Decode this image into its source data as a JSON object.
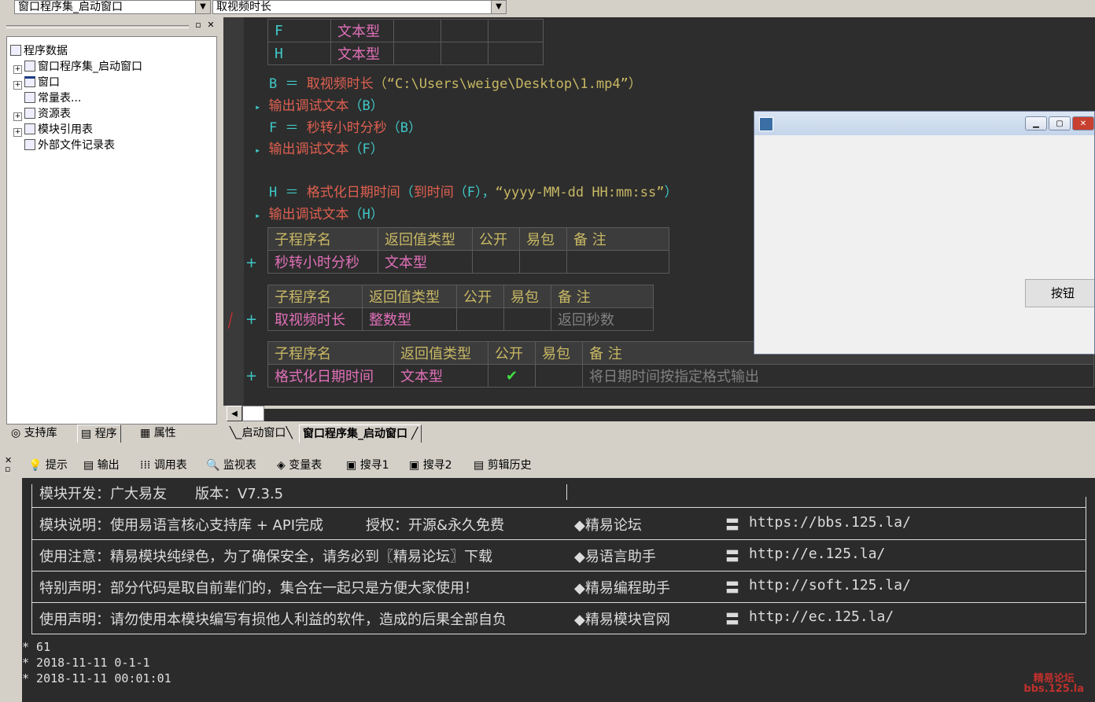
{
  "topbar": {
    "class_selector": "窗口程序集_启动窗口",
    "method_selector": "取视频时长"
  },
  "tree": {
    "root": "程序数据",
    "items": [
      {
        "label": "窗口程序集_启动窗口",
        "icon": "assembly-icon"
      },
      {
        "label": "窗口",
        "icon": "window-icon"
      },
      {
        "label": "常量表...",
        "icon": "constant-icon"
      },
      {
        "label": "资源表",
        "icon": "resource-icon"
      },
      {
        "label": "模块引用表",
        "icon": "module-icon"
      },
      {
        "label": "外部文件记录表",
        "icon": "file-icon"
      }
    ]
  },
  "left_tabs": [
    "支持库",
    "程序",
    "属性"
  ],
  "code": {
    "var_table": [
      [
        "F",
        "文本型"
      ],
      [
        "H",
        "文本型"
      ]
    ],
    "lines": {
      "l1_var": "B",
      "l1_eq": "＝",
      "l1_func": "取视频时长",
      "l1_arg": "（“C:\\Users\\weige\\Desktop\\1.mp4”）",
      "l2_func": "输出调试文本",
      "l2_arg": "（B）",
      "l3_var": "F",
      "l3_eq": "＝",
      "l3_func": "秒转小时分秒",
      "l3_arg": "（B）",
      "l4_func": "输出调试文本",
      "l4_arg": "（F）",
      "l5_var": "H",
      "l5_eq": "＝",
      "l5_func": "格式化日期时间",
      "l5_mid1": "（",
      "l5_func2": "到时间",
      "l5_mid2": "（F），",
      "l5_str": "“yyyy-MM-dd HH:mm:ss”",
      "l5_end": "）",
      "l6_func": "输出调试文本",
      "l6_arg": "（H）"
    },
    "sub_headers": [
      "子程序名",
      "返回值类型",
      "公开",
      "易包",
      "备 注"
    ],
    "subs": [
      {
        "name": "秒转小时分秒",
        "type": "文本型",
        "public": "",
        "note": ""
      },
      {
        "name": "取视频时长",
        "type": "整数型",
        "public": "",
        "note": "返回秒数"
      },
      {
        "name": "格式化日期时间",
        "type": "文本型",
        "public": "✔",
        "note": "将日期时间按指定格式输出"
      }
    ]
  },
  "doc_tabs": [
    "_启动窗口",
    "窗口程序集_启动窗口"
  ],
  "window": {
    "button_label": "按钮"
  },
  "bottom_tabs": [
    "提示",
    "输出",
    "调用表",
    "监视表",
    "变量表",
    "搜寻1",
    "搜寻2",
    "剪辑历史"
  ],
  "output": {
    "row0": {
      "left": "模块开发：广大易友　　版本：V7.3.5"
    },
    "rows": [
      {
        "left": "模块说明：使用易语言核心支持库 + API完成　　　授权：开源&永久免费",
        "site": "◆精易论坛",
        "url": "https://bbs.125.la/"
      },
      {
        "left": "使用注意：精易模块纯绿色，为了确保安全，请务必到〖精易论坛〗下载",
        "site": "◆易语言助手",
        "url": "http://e.125.la/"
      },
      {
        "left": "特别声明：部分代码是取自前辈们的，集合在一起只是方便大家使用！",
        "site": "◆精易编程助手",
        "url": "http://soft.125.la/"
      },
      {
        "left": "使用声明：请勿使用本模块编写有损他人利益的软件，造成的后果全部自负",
        "site": "◆精易模块官网",
        "url": "http://ec.125.la/"
      }
    ],
    "eq": "〓",
    "results": [
      "* 61",
      "* 2018-11-11 0-1-1",
      "* 2018-11-11 00:01:01"
    ]
  },
  "watermark": {
    "line1": "精易论坛",
    "line2": "bbs.125.la"
  }
}
